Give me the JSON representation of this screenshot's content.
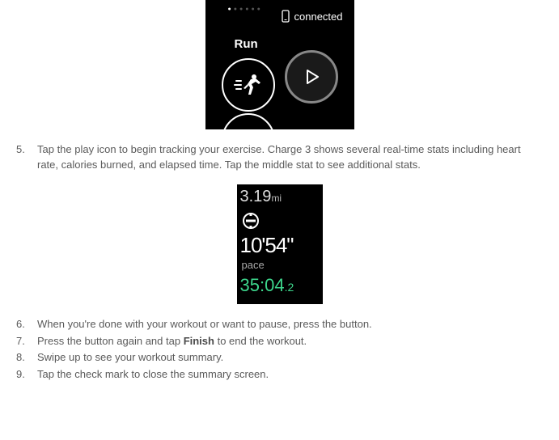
{
  "device1": {
    "status": "connected",
    "mode_label": "Run"
  },
  "device2": {
    "distance_value": "3.19",
    "distance_unit": "mi",
    "pace_value": "10'54\"",
    "pace_label": "pace",
    "elapsed_main": "35:04",
    "elapsed_frac": ".2"
  },
  "steps": {
    "s5_num": "5.",
    "s5_text": "Tap the play icon to begin tracking your exercise. Charge 3 shows several real-time stats including heart rate, calories burned, and elapsed time. Tap the middle stat to see additional stats.",
    "s6_num": "6.",
    "s6_text": "When you're done with your workout or want to pause, press the button.",
    "s7_num": "7.",
    "s7_pre": "Press the button again and tap ",
    "s7_bold": "Finish",
    "s7_post": " to end the workout.",
    "s8_num": "8.",
    "s8_text": "Swipe up to see your workout summary.",
    "s9_num": "9.",
    "s9_text": "Tap the check mark to close the summary screen."
  }
}
